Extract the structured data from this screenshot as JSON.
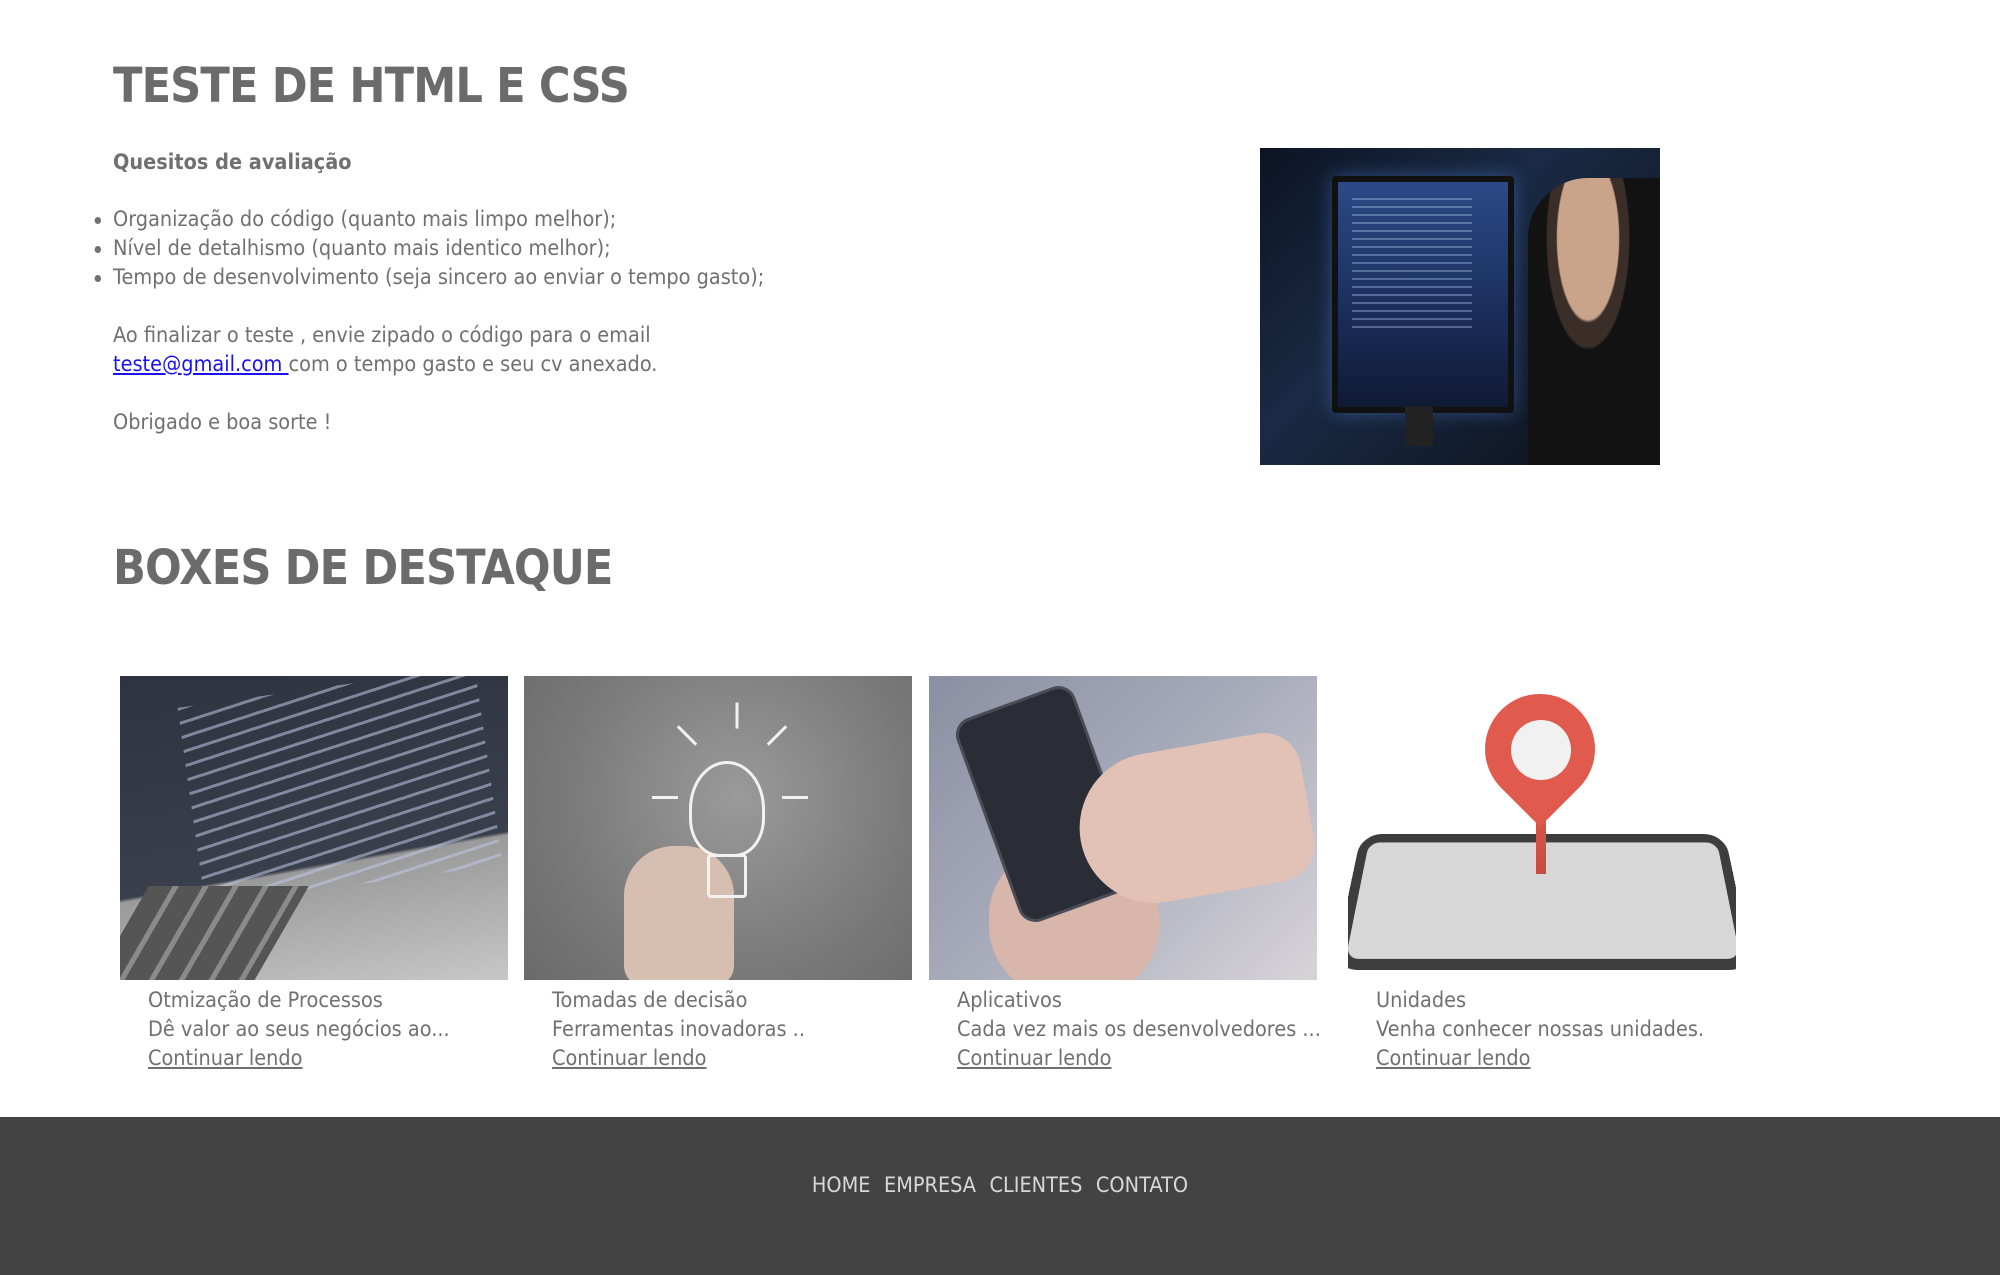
{
  "intro": {
    "title": "TESTE DE HTML E CSS",
    "criteria_heading": "Quesitos de avaliação",
    "criteria": [
      "Organização do código (quanto mais limpo melhor);",
      "Nível de detalhismo (quanto mais identico melhor);",
      "Tempo de desenvolvimento (seja sincero ao enviar o tempo gasto);"
    ],
    "send_before": "Ao finalizar o teste , envie zipado o código para o email ",
    "email": "teste@gmail.com ",
    "send_after": "com o tempo gasto e seu cv anexado.",
    "thanks": "Obrigado e boa sorte !"
  },
  "boxes": {
    "title": "BOXES DE DESTAQUE",
    "items": [
      {
        "title": "Otmização de Processos",
        "text": "Dê valor ao seus negócios ao...",
        "link": "Continuar lendo"
      },
      {
        "title": "Tomadas de decisão",
        "text": "Ferramentas inovadoras ..",
        "link": "Continuar lendo"
      },
      {
        "title": "Aplicativos",
        "text": "Cada vez mais os desenvolvedores ...",
        "link": "Continuar lendo"
      },
      {
        "title": "Unidades",
        "text": "Venha conhecer nossas unidades.",
        "link": "Continuar lendo"
      }
    ]
  },
  "footer": {
    "nav": [
      "HOME",
      "EMPRESA",
      "CLIENTES",
      "CONTATO"
    ]
  },
  "colors": {
    "text": "#707070",
    "link": "#1a12ee",
    "footer_bg": "#434343"
  }
}
